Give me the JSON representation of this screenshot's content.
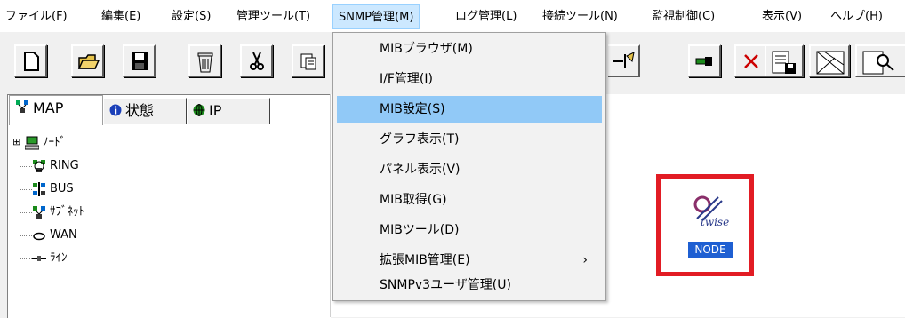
{
  "menubar": {
    "items": [
      {
        "label": "ファイル(F)"
      },
      {
        "label": "編集(E)"
      },
      {
        "label": "設定(S)"
      },
      {
        "label": "管理ツール(T)"
      },
      {
        "label": "SNMP管理(M)"
      },
      {
        "label": "ログ管理(L)"
      },
      {
        "label": "接続ツール(N)"
      },
      {
        "label": "監視制御(C)"
      },
      {
        "label": "表示(V)"
      },
      {
        "label": "ヘルプ(H)"
      }
    ],
    "open_index": 4
  },
  "toolbar": {
    "buttons": [
      {
        "icon": "new-file-icon"
      },
      {
        "icon": "open-folder-icon"
      },
      {
        "icon": "save-disk-icon"
      },
      {
        "icon": "trash-icon"
      },
      {
        "icon": "cut-scissors-icon"
      },
      {
        "icon": "paste-icon"
      },
      {
        "icon": "connect-tool-icon"
      },
      {
        "icon": "link-icon"
      },
      {
        "icon": "delete-x-icon"
      },
      {
        "icon": "save-document-icon"
      },
      {
        "icon": "map-image-icon"
      },
      {
        "icon": "search-page-icon"
      }
    ]
  },
  "tabs": [
    {
      "label": "MAP",
      "icon": "map-icon",
      "active": true
    },
    {
      "label": "状態",
      "icon": "info-icon",
      "active": false
    },
    {
      "label": "IP",
      "icon": "globe-icon",
      "active": false
    }
  ],
  "tree": {
    "items": [
      {
        "label": "ﾉｰﾄﾞ",
        "icon": "node-computer-icon",
        "expander": "⊞"
      },
      {
        "label": "RING",
        "icon": "ring-network-icon"
      },
      {
        "label": "BUS",
        "icon": "bus-network-icon"
      },
      {
        "label": "ｻﾌﾞﾈｯﾄ",
        "icon": "subnet-icon"
      },
      {
        "label": "WAN",
        "icon": "wan-cloud-icon"
      },
      {
        "label": "ﾗｲﾝ",
        "icon": "line-icon"
      }
    ]
  },
  "dropdown": {
    "items": [
      {
        "label": "MIBブラウザ(M)"
      },
      {
        "label": "I/F管理(I)"
      },
      {
        "label": "MIB設定(S)",
        "selected": true
      },
      {
        "label": "グラフ表示(T)"
      },
      {
        "label": "パネル表示(V)"
      },
      {
        "label": "MIB取得(G)"
      },
      {
        "label": "MIBツール(D)"
      },
      {
        "label": "拡張MIB管理(E)",
        "submenu": "›"
      },
      {
        "label": "SNMPv3ユーザ管理(U)"
      }
    ]
  },
  "canvas": {
    "node": {
      "label": "NODE",
      "icon_text": "twise",
      "icon": "twise-logo-icon"
    }
  },
  "colors": {
    "highlight_box": "#e21c24",
    "selected_menu": "#91c9f7",
    "node_label_bg": "#1e5fd2"
  }
}
